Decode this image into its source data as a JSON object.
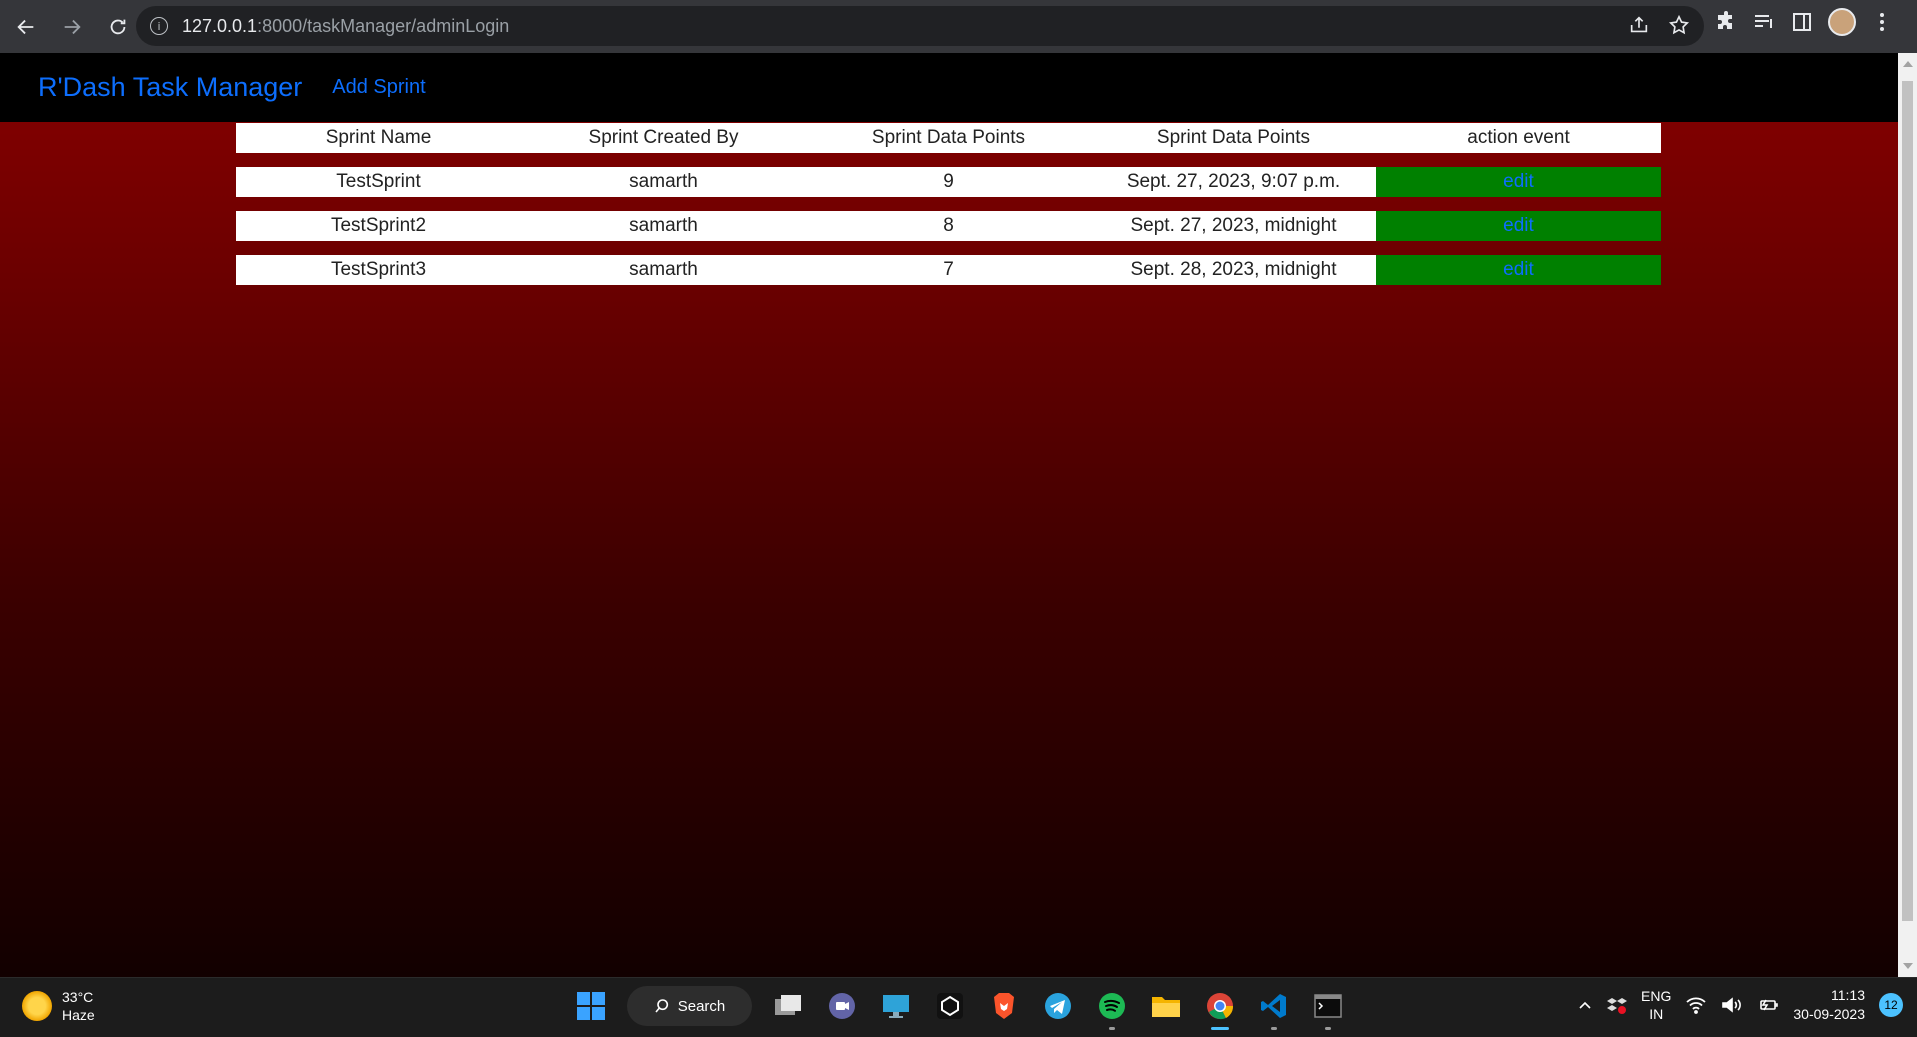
{
  "browser": {
    "url_host": "127.0.0.1",
    "url_rest": ":8000/taskManager/adminLogin"
  },
  "navbar": {
    "brand": "R'Dash Task Manager",
    "add_sprint": "Add Sprint"
  },
  "table": {
    "headers": [
      "Sprint Name",
      "Sprint Created By",
      "Sprint Data Points",
      "Sprint Data Points",
      "action event"
    ],
    "rows": [
      {
        "name": "TestSprint",
        "created_by": "samarth",
        "points": "9",
        "date": "Sept. 27, 2023, 9:07 p.m.",
        "action": "edit"
      },
      {
        "name": "TestSprint2",
        "created_by": "samarth",
        "points": "8",
        "date": "Sept. 27, 2023, midnight",
        "action": "edit"
      },
      {
        "name": "TestSprint3",
        "created_by": "samarth",
        "points": "7",
        "date": "Sept. 28, 2023, midnight",
        "action": "edit"
      }
    ]
  },
  "taskbar": {
    "temperature": "33°C",
    "weather": "Haze",
    "search_label": "Search",
    "lang_top": "ENG",
    "lang_bottom": "IN",
    "time": "11:13",
    "date": "30-09-2023",
    "notifications": "12"
  },
  "colors": {
    "accent": "#0d6efd",
    "action_cell": "#008000",
    "page_bg_top": "#880000",
    "page_bg_bottom": "#120000"
  }
}
